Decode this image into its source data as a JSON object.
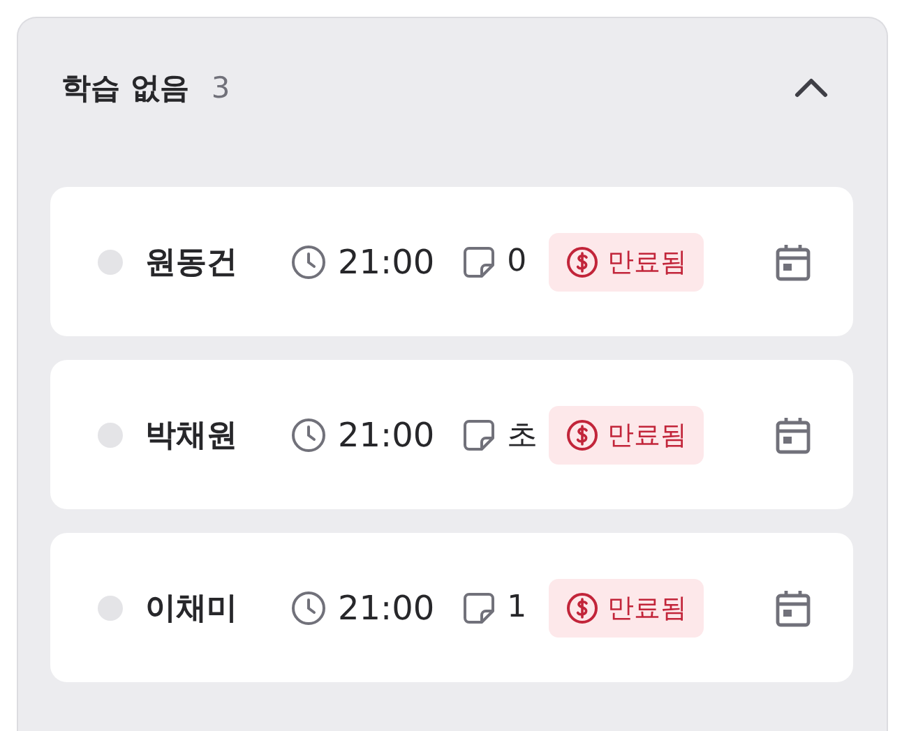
{
  "section": {
    "title": "학습 없음",
    "count": "3",
    "expanded": true
  },
  "students": [
    {
      "name": "원동건",
      "time": "21:00",
      "note": "0",
      "badge": "만료됨"
    },
    {
      "name": "박채원",
      "time": "21:00",
      "note": "초",
      "badge": "만료됨"
    },
    {
      "name": "이채미",
      "time": "21:00",
      "note": "1",
      "badge": "만료됨"
    }
  ]
}
